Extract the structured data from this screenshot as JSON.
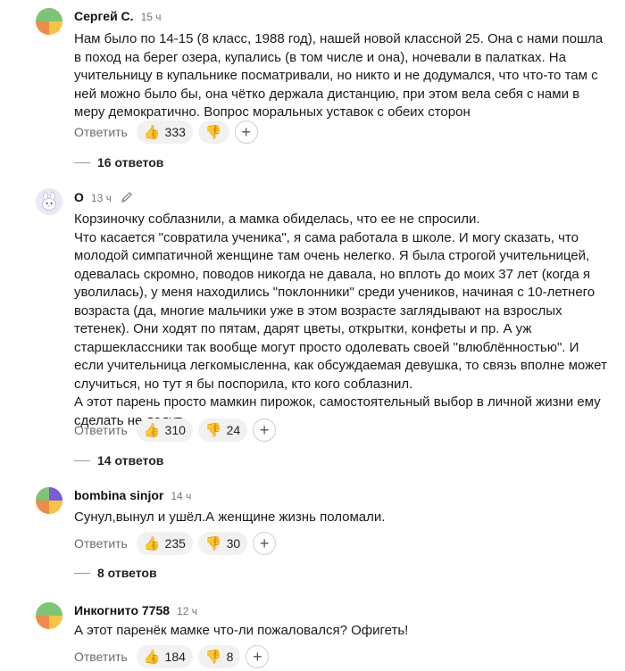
{
  "comments": [
    {
      "author": "Сергей С.",
      "time": "15 ч",
      "text": "Нам было по 14-15 (8 класс, 1988 год), нашей новой классной 25. Она с нами пошла в поход на берег озера, купались (в том числе и она), ночевали в палатках. На учительницу в купальнике посматривали, но никто и не додумался, что что-то там с ней можно было бы, она чётко держала дистанцию, при этом вела себя с нами в меру демократично. Вопрос моральных уставок с обеих сторон",
      "reply_label": "Ответить",
      "likes": "333",
      "dislikes": "",
      "replies": "16 ответов"
    },
    {
      "author": "О",
      "time": "13 ч",
      "text": "Корзиночку соблазнили, а мамка обиделась, что ее не спросили.\nЧто касается \"совратила ученика\", я сама работала в школе. И могу сказать, что молодой симпатичной женщине там очень нелегко. Я была строгой учительницей, одевалась скромно, поводов никогда не давала, но вплоть до моих 37 лет (когда я уволилась), у меня находились \"поклонники\" среди учеников, начиная с 10-летнего возраста (да, многие мальчики уже в этом возрасте заглядывают на взрослых тетенек). Они ходят по пятам, дарят цветы, открытки, конфеты и пр. А уж старшеклассники так вообще могут просто одолевать своей \"влюблённостью\". И если учительница легкомысленна, как обсуждаемая девушка, то связь вполне может случиться, но тут я бы поспорила, кто кого соблазнил.\nА этот парень просто мамкин пирожок, самостоятельный выбор в личной жизни ему сделать не дадут.",
      "reply_label": "Ответить",
      "likes": "310",
      "dislikes": "24",
      "replies": "14 ответов"
    },
    {
      "author": "bombina sinjor",
      "time": "14 ч",
      "text": "Сунул,вынул и ушёл.А женщине жизнь поломали.",
      "reply_label": "Ответить",
      "likes": "235",
      "dislikes": "30",
      "replies": "8 ответов"
    },
    {
      "author": "Инкогнито 7758",
      "time": "12 ч",
      "text": "А этот паренёк мамке что-ли пожаловался? Офигеть!",
      "reply_label": "Ответить",
      "likes": "184",
      "dislikes": "8"
    }
  ],
  "icons": {
    "like": "thumbs-up-icon",
    "dislike": "thumbs-down-icon",
    "add": "plus-icon",
    "edit": "pencil-icon"
  },
  "add_symbol": "+",
  "colors": {
    "avatar_green": "#7cc576",
    "avatar_orange": "#f08a4b",
    "avatar_purple": "#7b5cd6",
    "avatar_yellow": "#f6c343",
    "reaction_bg": "#f1f1f1"
  }
}
